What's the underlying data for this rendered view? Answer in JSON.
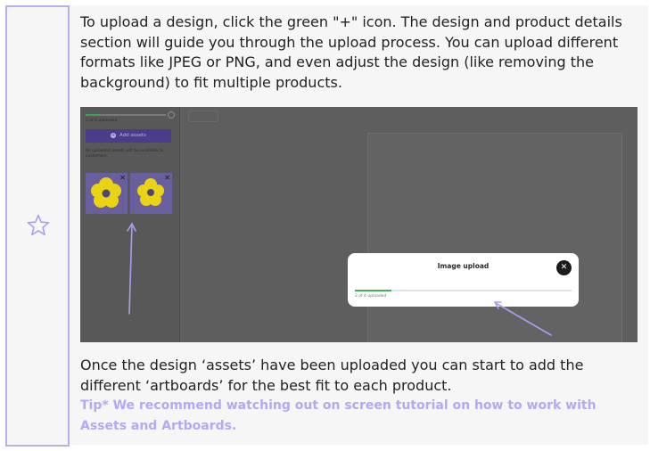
{
  "intro_text": "To upload a design, click the green \"+\" icon. The design and product details section will guide you through the upload process. You can upload different formats like JPEG or PNG, and even adjust the design (like removing the background) to fit multiple products.",
  "outro_text": "Once the design ‘assets’ have been uploaded you can start to add the different ‘artboards’ for the best fit to each product.",
  "tip_text": "Tip* We recommend watching out on screen tutorial on how to work with Assets and Artboards.",
  "screenshot": {
    "sidebar": {
      "progress_label": "2 of 4 uploaded",
      "progress_fraction": 0.18,
      "add_assets_label": "Add assets",
      "note": "All uploaded assets will be available to customers."
    },
    "dialog": {
      "title": "Image upload",
      "close_glyph": "✕",
      "progress_label": "2 of 4 uploaded",
      "progress_fraction": 0.17
    }
  },
  "colors": {
    "accent_purple": "#b5a8f5",
    "border_purple": "#b8b0ee",
    "upload_green": "#3fb35a",
    "flower_yellow": "#e8d414"
  },
  "icons": {
    "side_icon": "star-outline-icon",
    "asset_close": "close-icon"
  }
}
